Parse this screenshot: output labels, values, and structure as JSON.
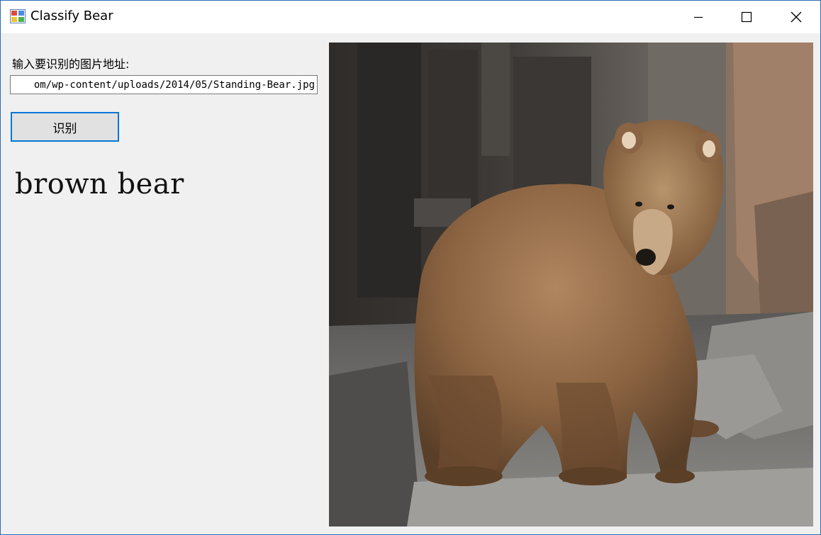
{
  "window": {
    "title": "Classify Bear",
    "accent_color": "#0078d7",
    "controls": {
      "minimize_icon": "minimize-icon",
      "maximize_icon": "maximize-icon",
      "close_icon": "close-icon"
    }
  },
  "form": {
    "prompt_label": "输入要识别的图片地址:",
    "url_value": "om/wp-content/uploads/2014/05/Standing-Bear.jpg",
    "classify_button_label": "识别",
    "result": "brown bear"
  },
  "image": {
    "subject": "brown bear standing on rocks"
  }
}
